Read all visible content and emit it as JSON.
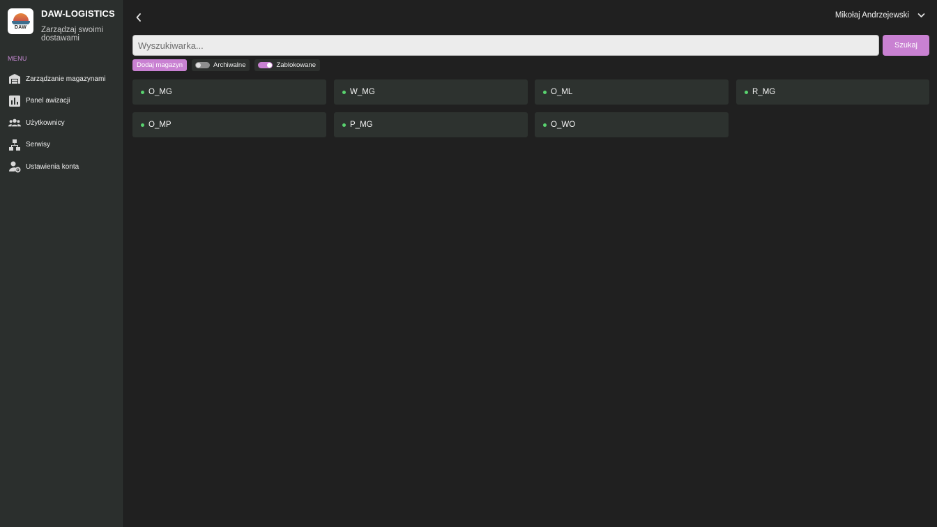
{
  "brand": {
    "title": "DAW-LOGISTICS",
    "subtitle": "Zarządzaj swoimi dostawami",
    "logo_text": "DAW"
  },
  "sidebar": {
    "menu_label": "MENU",
    "items": [
      {
        "label": "Zarządzanie magazynami",
        "icon": "warehouse-icon"
      },
      {
        "label": "Panel awizacji",
        "icon": "bar-chart-icon"
      },
      {
        "label": "Użytkownicy",
        "icon": "users-icon"
      },
      {
        "label": "Serwisy",
        "icon": "sitemap-icon"
      },
      {
        "label": "Ustawienia konta",
        "icon": "user-gear-icon"
      }
    ]
  },
  "header": {
    "user_name": "Mikołaj Andrzejewski"
  },
  "search": {
    "placeholder": "Wyszukiwarka...",
    "value": "",
    "button_label": "Szukaj"
  },
  "filters": {
    "add_label": "Dodaj magazyn",
    "archived_label": "Archiwalne",
    "archived_on": false,
    "blocked_label": "Zablokowane",
    "blocked_on": true
  },
  "warehouses": [
    {
      "name": "O_MG",
      "status": "active"
    },
    {
      "name": "W_MG",
      "status": "active"
    },
    {
      "name": "O_ML",
      "status": "active"
    },
    {
      "name": "R_MG",
      "status": "active"
    },
    {
      "name": "O_MP",
      "status": "active"
    },
    {
      "name": "P_MG",
      "status": "active"
    },
    {
      "name": "O_WO",
      "status": "active"
    }
  ],
  "colors": {
    "accent": "#c981d2",
    "status_active": "#59d36f",
    "background": "#202020",
    "sidebar": "#2b2f2d"
  }
}
